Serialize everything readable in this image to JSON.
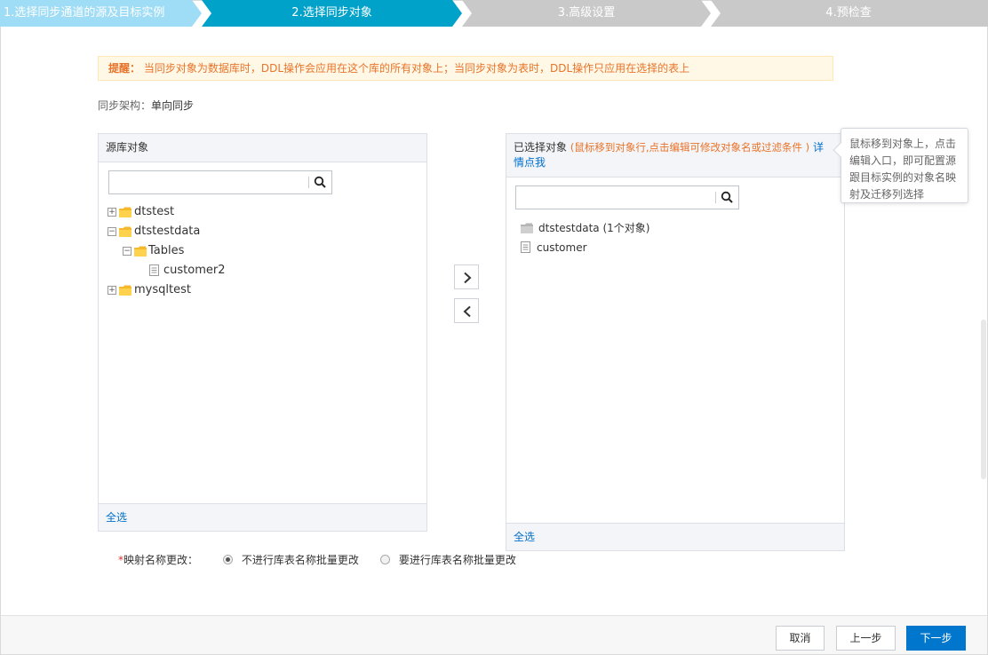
{
  "steps": [
    {
      "label": "1.选择同步通道的源及目标实例",
      "state": "done"
    },
    {
      "label": "2.选择同步对象",
      "state": "active"
    },
    {
      "label": "3.高级设置",
      "state": "todo"
    },
    {
      "label": "4.预检查",
      "state": "todo"
    }
  ],
  "colors": {
    "step_done": "#9fdcf5",
    "step_active": "#00a2ca",
    "step_todo": "#c9c9c9",
    "link": "#0070cc",
    "warn": "#e8742b",
    "primary": "#0077cc"
  },
  "notice": {
    "prefix": "提醒：",
    "text": "当同步对象为数据库时，DDL操作会应用在这个库的所有对象上；当同步对象为表时，DDL操作只应用在选择的表上"
  },
  "arch": {
    "label": "同步架构：",
    "value": "单向同步"
  },
  "source_panel": {
    "title": "源库对象",
    "search_placeholder": "",
    "tree": [
      {
        "label": "dtstest",
        "toggle": "+",
        "type": "folder"
      },
      {
        "label": "dtstestdata",
        "toggle": "−",
        "type": "folder"
      },
      {
        "label": "Tables",
        "toggle": "−",
        "type": "folder"
      },
      {
        "label": "customer2",
        "toggle": "",
        "type": "file"
      },
      {
        "label": "mysqltest",
        "toggle": "+",
        "type": "folder"
      }
    ],
    "select_all": "全选"
  },
  "transfer": {
    "add_icon": "chevron-right-icon",
    "remove_icon": "chevron-left-icon"
  },
  "selected_panel": {
    "title": "已选择对象",
    "hint": "(鼠标移到对象行,点击编辑可修改对象名或过滤条件 )",
    "link_part1": "详",
    "link_part2": "情点我",
    "search_placeholder": "",
    "tree": [
      {
        "label": "dtstestdata (1个对象)",
        "type": "folder"
      },
      {
        "label": "customer",
        "type": "file"
      }
    ],
    "select_all": "全选"
  },
  "tooltip": {
    "lines": [
      "鼠标移到对象上，点击",
      "编辑入口，即可配置源",
      "跟目标实例的对象名映",
      "射及迁移列选择"
    ]
  },
  "mapping": {
    "required_mark": "*",
    "label": "映射名称更改：",
    "options": [
      {
        "label": "不进行库表名称批量更改",
        "selected": true
      },
      {
        "label": "要进行库表名称批量更改",
        "selected": false
      }
    ]
  },
  "buttons": {
    "cancel": "取消",
    "prev": "上一步",
    "next": "下一步"
  }
}
